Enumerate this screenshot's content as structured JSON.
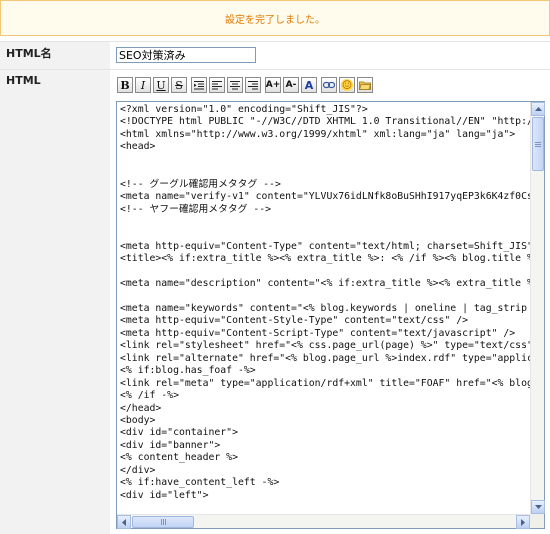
{
  "notice": {
    "message": "設定を完了しました。"
  },
  "form": {
    "name_label": "HTML名",
    "name_value": "SEO対策済み",
    "html_label": "HTML"
  },
  "toolbar": {
    "buttons": [
      {
        "name": "bold-icon",
        "glyph": "B"
      },
      {
        "name": "italic-icon",
        "glyph": "I"
      },
      {
        "name": "underline-icon",
        "glyph": "U"
      },
      {
        "name": "strikethrough-icon",
        "glyph": "S"
      },
      {
        "name": "indent-icon",
        "glyph": ""
      },
      {
        "name": "align-left-icon",
        "glyph": ""
      },
      {
        "name": "align-center-icon",
        "glyph": ""
      },
      {
        "name": "align-right-icon",
        "glyph": ""
      },
      {
        "name": "font-size-increase-icon",
        "glyph": "A+"
      },
      {
        "name": "font-size-decrease-icon",
        "glyph": "A-"
      },
      {
        "name": "font-color-icon",
        "glyph": "A"
      },
      {
        "name": "link-icon",
        "glyph": ""
      },
      {
        "name": "emoji-icon",
        "glyph": "☺"
      },
      {
        "name": "folder-icon",
        "glyph": ""
      }
    ]
  },
  "editor": {
    "lines": [
      "<?xml version=\"1.0\" encoding=\"Shift_JIS\"?>",
      "<!DOCTYPE html PUBLIC \"-//W3C//DTD XHTML 1.0 Transitional//EN\" \"http://",
      "<html xmlns=\"http://www.w3.org/1999/xhtml\" xml:lang=\"ja\" lang=\"ja\">",
      "<head>",
      "",
      "",
      "<!-- グーグル確認用メタタグ -->",
      "<meta name=\"verify-v1\" content=\"YLVUx76idLNfk8oBuSHhI917yqEP3k6K4zf0Cs",
      "<!-- ヤフー確認用メタタグ -->",
      "",
      "",
      "<meta http-equiv=\"Content-Type\" content=\"text/html; charset=Shift_JIS\"",
      "<title><% if:extra_title %><% extra_title %>: <% /if %><% blog.title %",
      "",
      "<meta name=\"description\" content=\"<% if:extra_title %><% extra_title %",
      "",
      "<meta name=\"keywords\" content=\"<% blog.keywords | oneline | tag_strip",
      "<meta http-equiv=\"Content-Style-Type\" content=\"text/css\" />",
      "<meta http-equiv=\"Content-Script-Type\" content=\"text/javascript\" />",
      "<link rel=\"stylesheet\" href=\"<% css.page_url(page) %>\" type=\"text/css\"",
      "<link rel=\"alternate\" href=\"<% blog.page_url %>index.rdf\" type=\"applica",
      "<% if:blog.has_foaf -%>",
      "<link rel=\"meta\" type=\"application/rdf+xml\" title=\"FOAF\" href=\"<% blog",
      "<% /if -%>",
      "</head>",
      "<body>",
      "<div id=\"container\">",
      "<div id=\"banner\">",
      "<% content_header %>",
      "</div>",
      "<% if:have_content_left -%>",
      "<div id=\"left\">"
    ]
  }
}
